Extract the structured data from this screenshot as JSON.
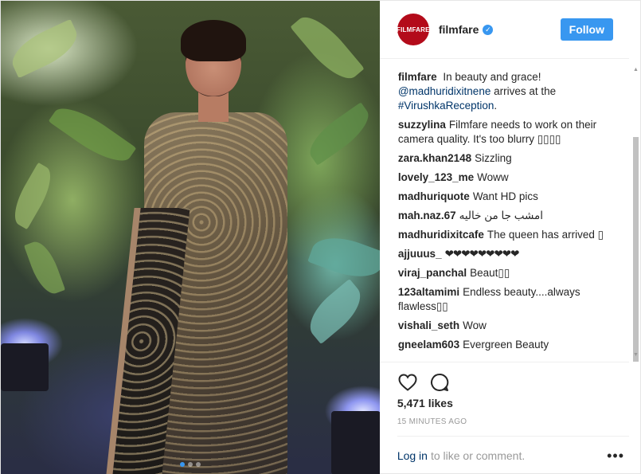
{
  "post": {
    "account": {
      "avatar_text": "FILMFARE",
      "username": "filmfare",
      "verified_icon": "verified-badge-icon",
      "follow_label": "Follow",
      "accent_color": "#3897f0",
      "avatar_color": "#b30b1a"
    },
    "caption": {
      "user": "filmfare",
      "text_1": "In beauty and grace!",
      "mention": "@madhuridixitnene",
      "text_2": "arrives at the",
      "hashtag": "#VirushkaReception",
      "text_3": "."
    },
    "comments": [
      {
        "user": "suzzylina",
        "text": "Filmfare needs to work on their camera quality. It's too blurry ▯▯▯▯"
      },
      {
        "user": "zara.khan2148",
        "text": "Sizzling"
      },
      {
        "user": "lovely_123_me",
        "text": "Woww"
      },
      {
        "user": "madhuriquote",
        "text": "Want HD pics"
      },
      {
        "user": "mah.naz.67",
        "text": "امشب جا من خالیه"
      },
      {
        "user": "madhuridixitcafe",
        "text": "The queen has arrived ▯"
      },
      {
        "user": "ajjuuus_",
        "text": "❤❤❤❤❤❤❤❤❤"
      },
      {
        "user": "viraj_panchal",
        "text": "Beaut▯▯"
      },
      {
        "user": "123altamimi",
        "text": "Endless beauty....always flawless▯▯"
      },
      {
        "user": "vishali_seth",
        "text": "Wow"
      },
      {
        "user": "gneelam603",
        "text": "Evergreen Beauty"
      },
      {
        "user": "",
        "text": ""
      }
    ],
    "likes": "5,471 likes",
    "timestamp": "15 MINUTES AGO",
    "footer": {
      "login_label": "Log in",
      "rest": "to like or comment.",
      "more_label": "•••"
    },
    "carousel": {
      "current": 1,
      "total": 3
    }
  }
}
